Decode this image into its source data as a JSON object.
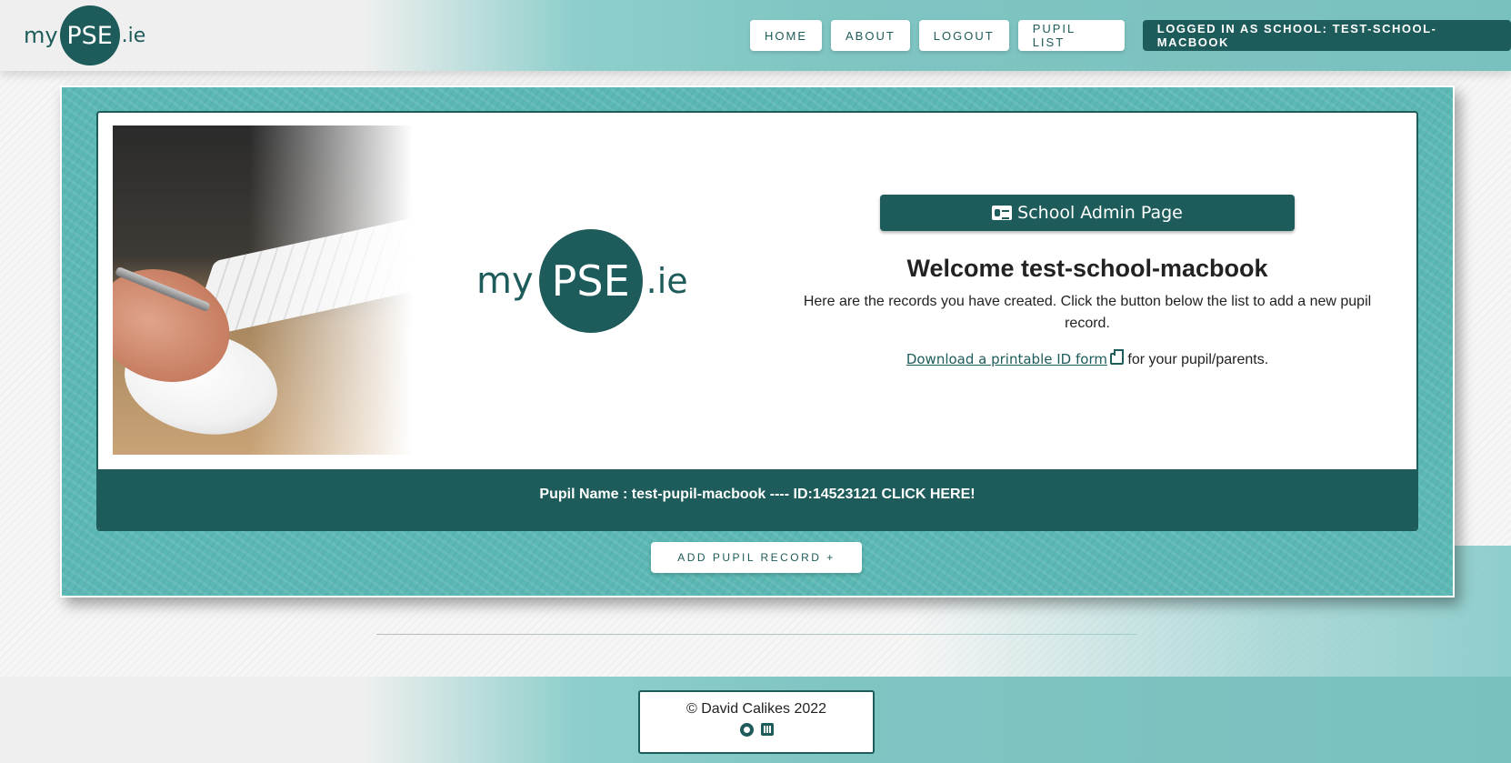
{
  "header": {
    "brand": {
      "prefix": "my",
      "mark": "PSE",
      "suffix": ".ie"
    },
    "nav": [
      {
        "label": "HOME"
      },
      {
        "label": "ABOUT"
      },
      {
        "label": "LOGOUT"
      },
      {
        "label": "PUPIL LIST"
      }
    ],
    "status": "LOGGED IN AS SCHOOL: TEST-SCHOOL-MACBOOK"
  },
  "main": {
    "logo": {
      "prefix": "my",
      "mark": "PSE",
      "suffix": ".ie"
    },
    "admin_button": {
      "label": "School Admin Page",
      "icon": "id-card-icon"
    },
    "welcome": "Welcome test-school-macbook",
    "intro": "Here are the records you have created. Click the button below the list to add a new pupil record.",
    "download": {
      "link_text": "Download a printable ID form",
      "icon": "print-icon",
      "after_text": " for your pupil/parents."
    },
    "pupil_record": "Pupil Name : test-pupil-macbook ---- ID:14523121 CLICK HERE!",
    "add_button": "ADD PUPIL RECORD +"
  },
  "footer": {
    "copyright": "© David Calikes 2022",
    "icons": [
      "github-icon",
      "linkedin-icon"
    ]
  },
  "colors": {
    "primary": "#1d5c5a",
    "teal": "#5bb8b4",
    "white": "#ffffff"
  }
}
